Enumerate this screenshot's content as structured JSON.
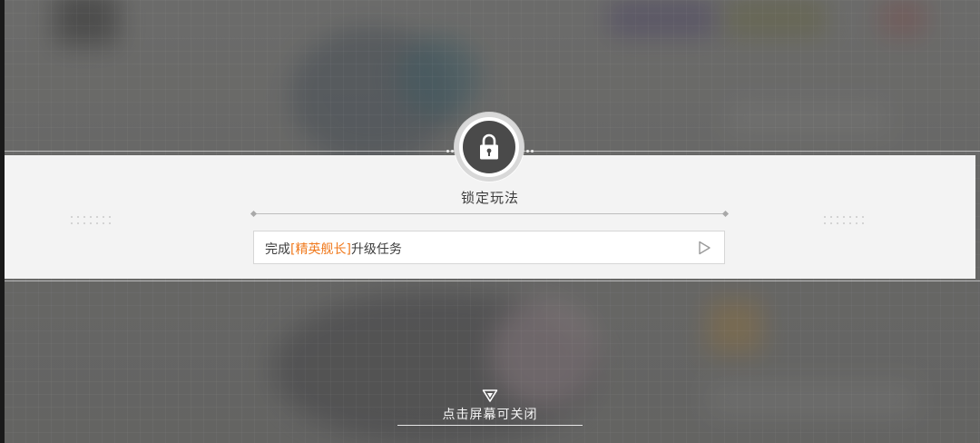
{
  "modal": {
    "title": "锁定玩法",
    "icon": "lock-icon",
    "task": {
      "prefix": "完成",
      "highlight": "[精英舰长]",
      "suffix": "升级任务",
      "highlight_color": "#f07a1e",
      "action_icon": "play-triangle-icon"
    }
  },
  "footer": {
    "close_hint": "点击屏幕可关闭",
    "icon": "down-triangle-icon"
  }
}
